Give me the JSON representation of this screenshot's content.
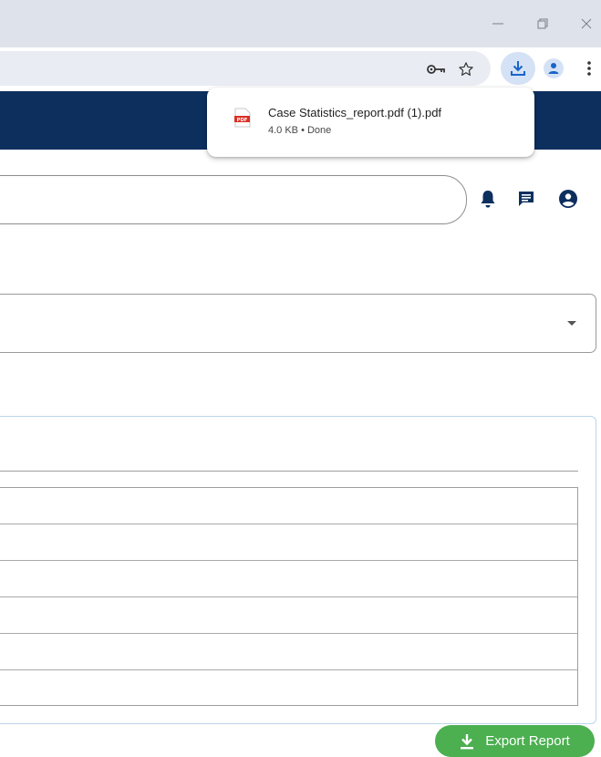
{
  "download": {
    "file_name": "Case Statistics_report.pdf (1).pdf",
    "status": "4.0 KB • Done",
    "file_badge": "PDF"
  },
  "actions": {
    "export_label": "Export Report"
  },
  "table": {
    "row_count": 6
  },
  "icons": {
    "minimize": "minimize-icon",
    "restore": "restore-icon",
    "close": "close-icon",
    "password_key": "key-icon",
    "bookmark": "star-icon",
    "downloads": "download-icon",
    "profile": "profile-icon",
    "browser_menu": "more-vert-icon",
    "notifications": "bell-icon",
    "messages": "message-icon",
    "account": "account-circle-icon",
    "dropdown": "caret-down-icon",
    "export": "download-icon"
  },
  "colors": {
    "app_header": "#0d2f5e",
    "export_button": "#4caf50",
    "download_button_bg": "#d5e2f5",
    "pdf_badge": "#d93025"
  }
}
